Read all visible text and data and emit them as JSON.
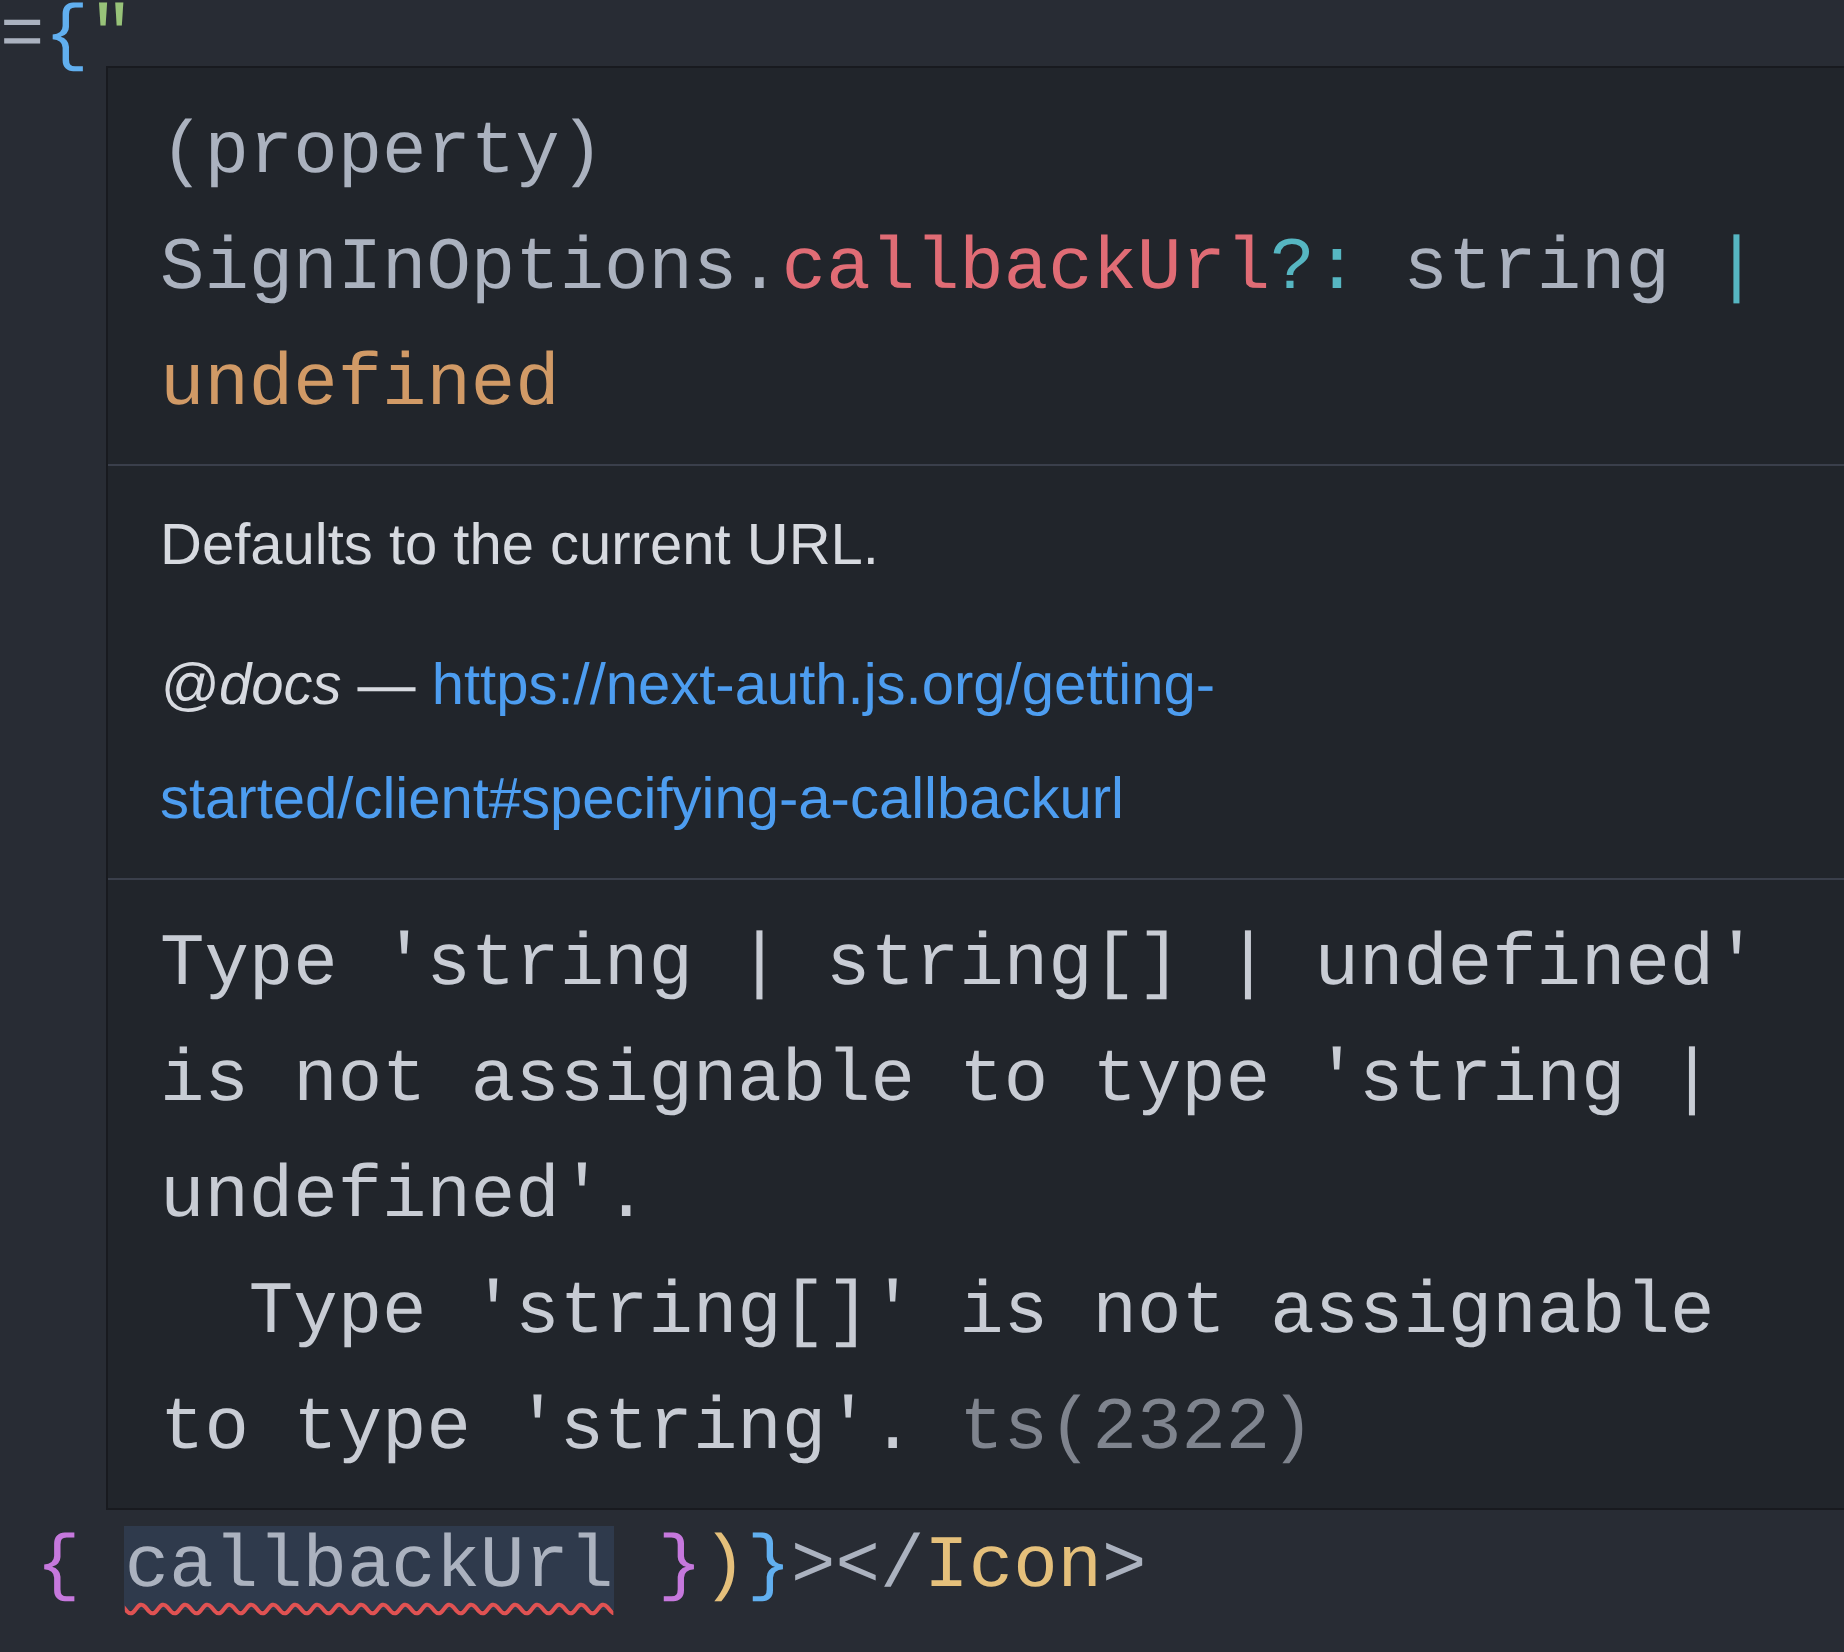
{
  "code_top": [
    {
      "text": "=",
      "kind": "plain"
    },
    {
      "text": "{",
      "kind": "brace-blue"
    },
    {
      "text": "\"",
      "kind": "string"
    }
  ],
  "tooltip": {
    "signature": [
      {
        "text": "(property) ",
        "kind": "plain"
      },
      {
        "text": "SignInOptions.",
        "kind": "plain"
      },
      {
        "text": "callbackUrl",
        "kind": "property"
      },
      {
        "text": "?:",
        "kind": "operator"
      },
      {
        "text": " string ",
        "kind": "plain"
      },
      {
        "text": "| ",
        "kind": "operator"
      },
      {
        "text": "undefined",
        "kind": "keyword"
      }
    ],
    "documentation": {
      "summary": "Defaults to the current URL.",
      "tag": "@docs",
      "dash": " — ",
      "link": "https://next-auth.js.org/getting-started/client#specifying-a-callbackurl"
    },
    "diagnostic": {
      "message": "Type 'string | string[] | undefined' is not assignable to type 'string | undefined'.\n  Type 'string[]' is not assignable to type 'string'.",
      "code": "ts(2322)"
    }
  },
  "code_bottom": [
    {
      "text": "{ ",
      "kind": "brace-purple"
    },
    {
      "text": "callbackUrl",
      "kind": "error-ident"
    },
    {
      "text": " }",
      "kind": "brace-purple"
    },
    {
      "text": ")",
      "kind": "paren-yellow"
    },
    {
      "text": "}",
      "kind": "brace-blue"
    },
    {
      "text": "></",
      "kind": "plain"
    },
    {
      "text": "Icon",
      "kind": "tag"
    },
    {
      "text": ">",
      "kind": "plain"
    }
  ]
}
